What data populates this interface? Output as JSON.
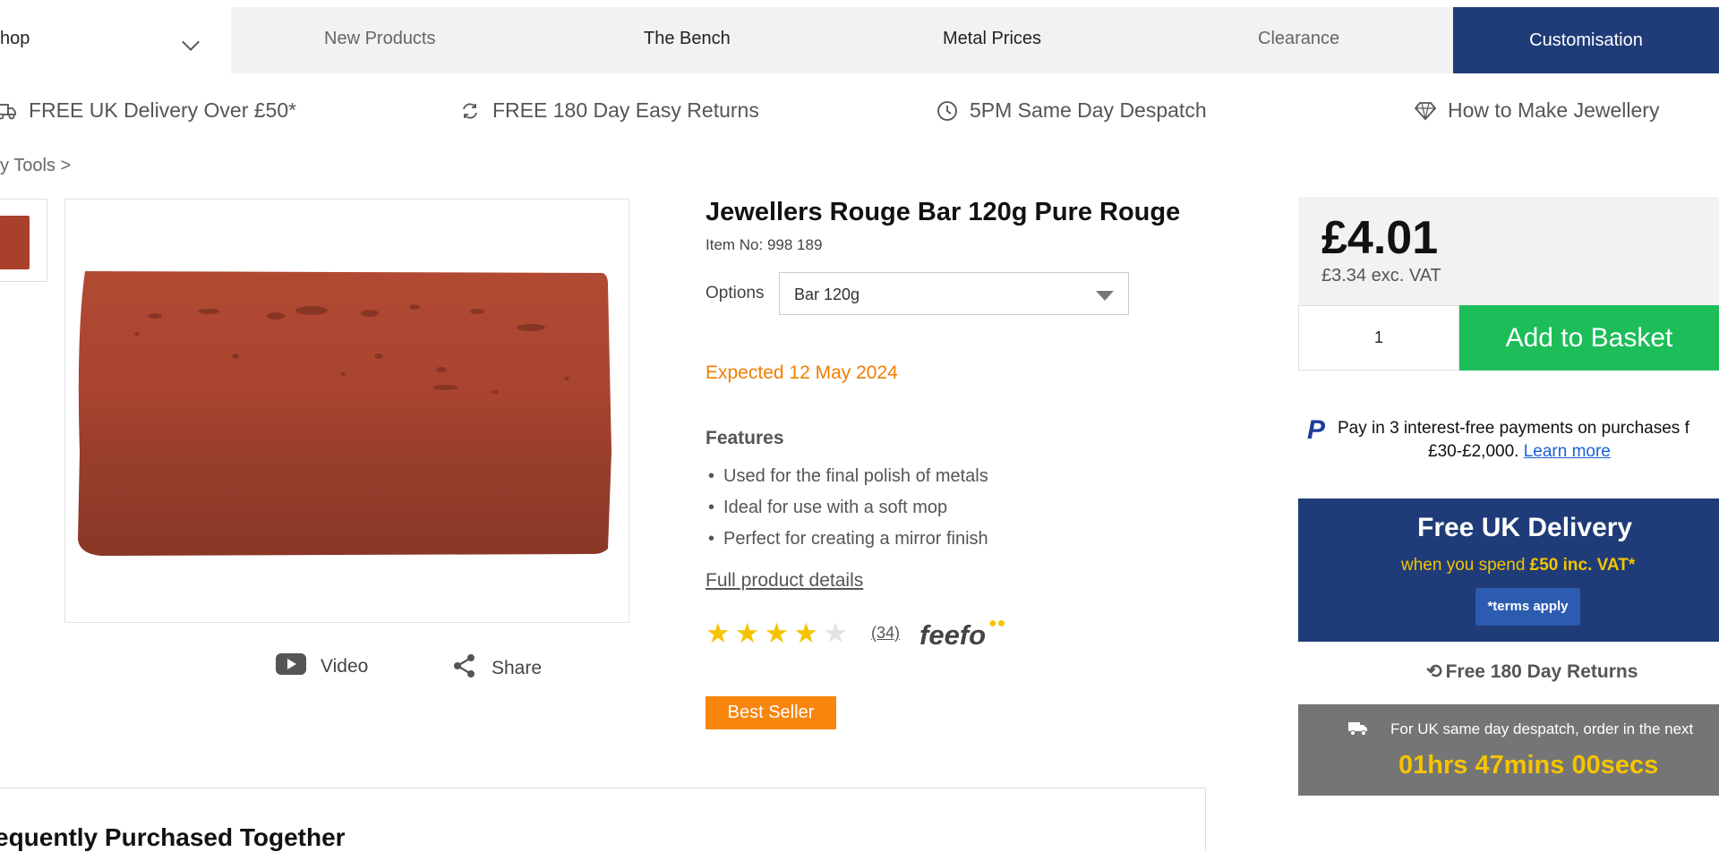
{
  "nav": {
    "shop_label": "hop",
    "items": [
      "New Products",
      "The Bench",
      "Metal Prices",
      "Clearance"
    ],
    "customisation": "Customisation"
  },
  "usps": [
    {
      "icon": "truck-icon",
      "label": "FREE UK Delivery Over £50*"
    },
    {
      "icon": "refresh-icon",
      "label": "FREE 180 Day Easy Returns"
    },
    {
      "icon": "clock-icon",
      "label": "5PM Same Day Despatch"
    },
    {
      "icon": "diamond-icon",
      "label": "How to Make Jewellery"
    }
  ],
  "breadcrumb": "y Tools  >",
  "media": {
    "video": "Video",
    "share": "Share"
  },
  "product": {
    "title": "Jewellers Rouge Bar 120g Pure Rouge",
    "item_no": "Item No: 998 189",
    "options_label": "Options",
    "option_selected": "Bar 120g",
    "expected": "Expected 12 May 2024",
    "features_heading": "Features",
    "features": [
      "Used for the final polish of metals",
      "Ideal for use with a soft mop",
      "Perfect for creating a mirror finish"
    ],
    "full_details": "Full product details",
    "rating": 4,
    "review_count": "(34)",
    "feefo": "feefo",
    "badge": "Best Seller"
  },
  "purchase": {
    "price": "£4.01",
    "ex_vat": "£3.34 exc. VAT",
    "quantity": "1",
    "add_to_basket": "Add to Basket"
  },
  "paypal": {
    "line1": "Pay in 3 interest-free payments on purchases f",
    "line2": "£30-£2,000.",
    "learn_more": "Learn more"
  },
  "delivery": {
    "heading": "Free UK Delivery",
    "sub_prefix": "when you spend ",
    "sub_amount": "£50 inc. VAT*",
    "terms": "*terms apply"
  },
  "returns": "Free 180 Day Returns",
  "despatch": {
    "text": "For UK same day despatch, order in the next",
    "countdown": "01hrs 47mins 00secs"
  },
  "frequently": "equently Purchased Together",
  "colors": {
    "navy": "#1f3c78",
    "green": "#1dbd5a",
    "orange": "#f7850e",
    "gold": "#f5c400"
  }
}
